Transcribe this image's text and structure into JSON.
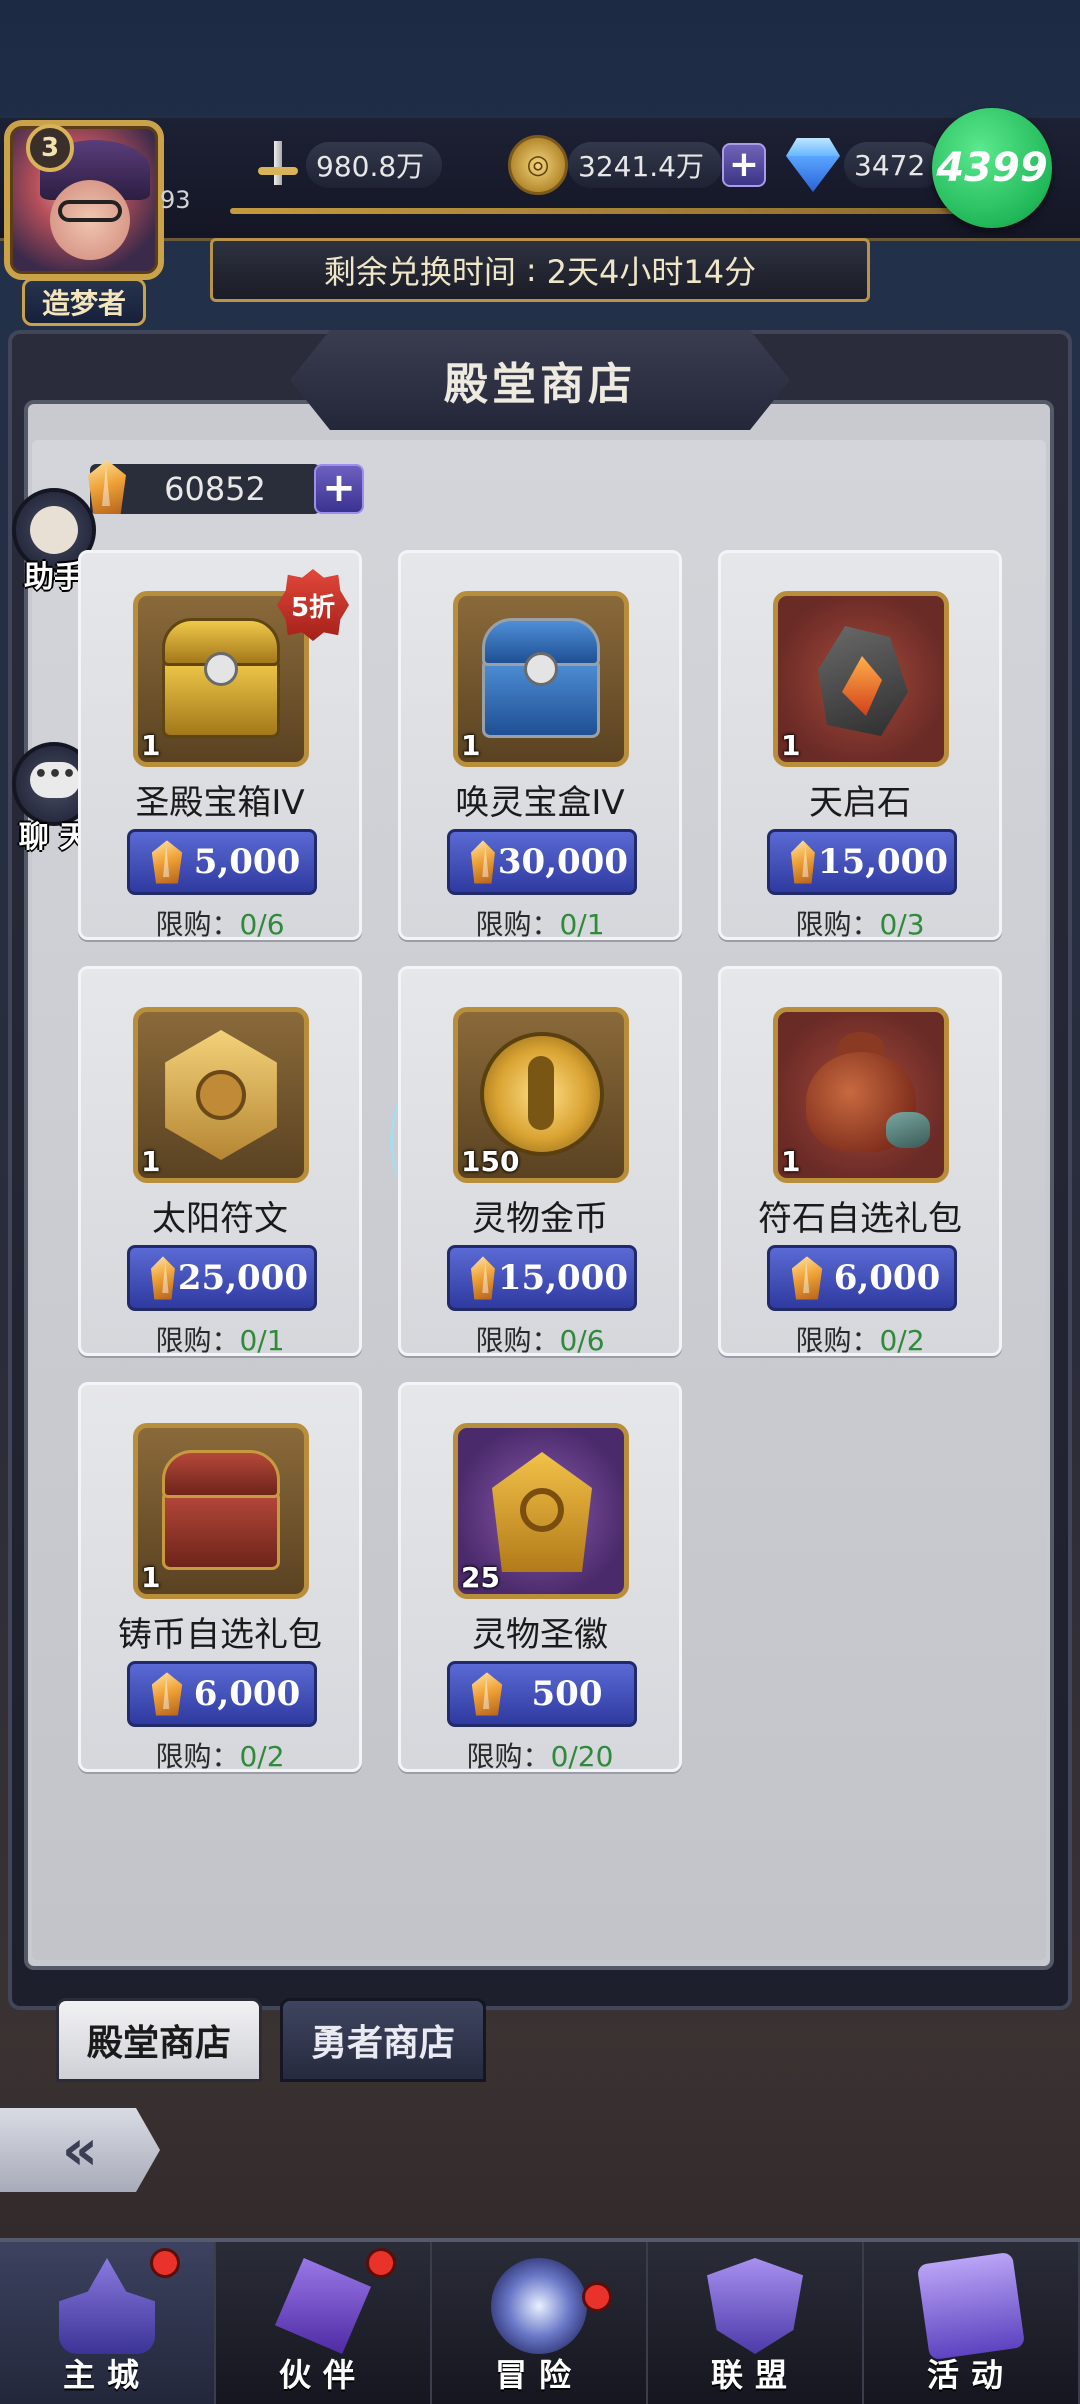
{
  "player": {
    "level": "3",
    "title": "造梦者",
    "exp_value": "93"
  },
  "resources": {
    "power": "980.8万",
    "gold": "3241.4万",
    "diamonds": "3472"
  },
  "brand": "4399",
  "timer": {
    "label": "剩余兑换时间",
    "separator": ":",
    "value": "2天4小时14分"
  },
  "shop": {
    "title": "殿堂商店",
    "currency_value": "60852",
    "limit_label": "限购：",
    "items": [
      {
        "name": "圣殿宝箱IV",
        "qty": "1",
        "price": "5,000",
        "limit": "0/6",
        "discount": "5折",
        "icon": "gold-chest-icon"
      },
      {
        "name": "唤灵宝盒IV",
        "qty": "1",
        "price": "30,000",
        "limit": "0/1",
        "icon": "blue-chest-icon"
      },
      {
        "name": "天启石",
        "qty": "1",
        "price": "15,000",
        "limit": "0/3",
        "icon": "apocalypse-stone-icon"
      },
      {
        "name": "太阳符文",
        "qty": "1",
        "price": "25,000",
        "limit": "0/1",
        "icon": "sun-rune-icon"
      },
      {
        "name": "灵物金币",
        "qty": "150",
        "price": "15,000",
        "limit": "0/6",
        "icon": "spirit-coin-icon"
      },
      {
        "name": "符石自选礼包",
        "qty": "1",
        "price": "6,000",
        "limit": "0/2",
        "icon": "runestone-bag-icon"
      },
      {
        "name": "铸币自选礼包",
        "qty": "1",
        "price": "6,000",
        "limit": "0/2",
        "icon": "red-chest-icon"
      },
      {
        "name": "灵物圣徽",
        "qty": "25",
        "price": "500",
        "limit": "0/20",
        "icon": "spirit-emblem-icon"
      }
    ]
  },
  "side_buttons": {
    "helper": "助手",
    "chat": "聊 天",
    "chat_bubble": "•••"
  },
  "tabs": [
    "殿堂商店",
    "勇者商店"
  ],
  "back_icon": "back-arrow-icon",
  "nav": [
    {
      "label": "主城",
      "icon": "castle-icon",
      "badge": true
    },
    {
      "label": "伙伴",
      "icon": "partner-icon",
      "badge": true
    },
    {
      "label": "冒险",
      "icon": "adventure-icon",
      "badge": true
    },
    {
      "label": "联盟",
      "icon": "alliance-icon",
      "badge": false
    },
    {
      "label": "活动",
      "icon": "activity-icon",
      "badge": false
    }
  ],
  "colors": {
    "price_button": "#3f4bbd",
    "limit_count": "#2f8a3a",
    "brand_green": "#22b95a",
    "notification_red": "#e8322a"
  }
}
